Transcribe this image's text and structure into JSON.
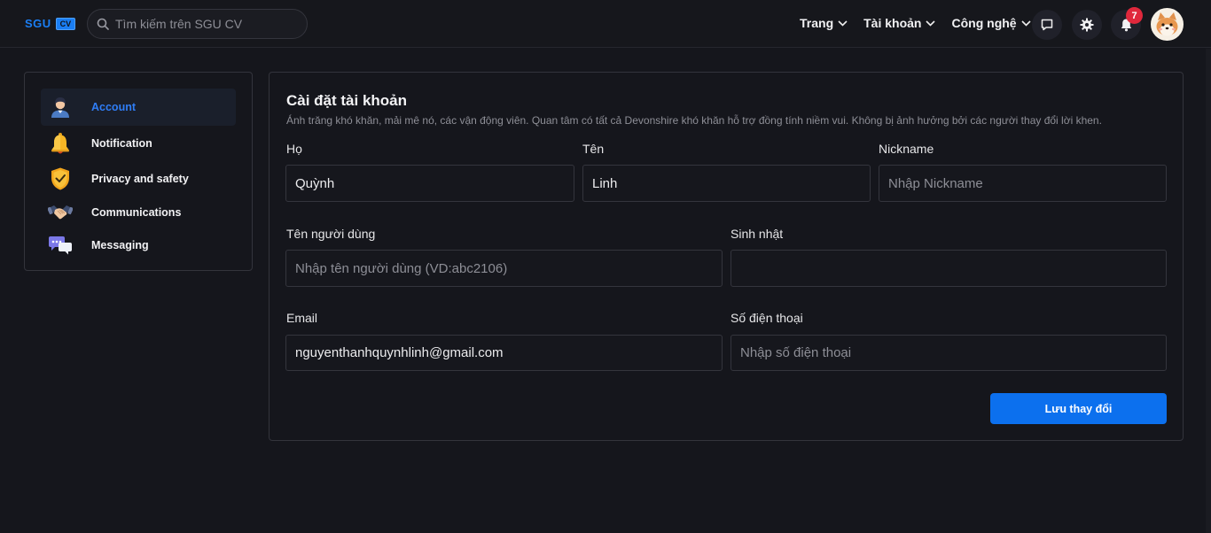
{
  "header": {
    "logo_main": "SGU",
    "logo_tag": "CV",
    "search_placeholder": "Tìm kiếm trên SGU CV",
    "nav": [
      {
        "label": "Trang"
      },
      {
        "label": "Tài khoản"
      },
      {
        "label": "Công nghệ"
      }
    ],
    "notification_count": "7",
    "accent_color": "#1a7ef4"
  },
  "sidebar": {
    "items": [
      {
        "label": "Account",
        "icon": "user-avatar-icon",
        "active": true
      },
      {
        "label": "Notification",
        "icon": "bell-icon"
      },
      {
        "label": "Privacy and safety",
        "icon": "shield-check-icon"
      },
      {
        "label": "Communications",
        "icon": "handshake-icon"
      },
      {
        "label": "Messaging",
        "icon": "chat-bubbles-icon"
      }
    ]
  },
  "form": {
    "title": "Cài đặt tài khoản",
    "description": "Ánh trăng khó khăn, mải mê nó, các vận động viên. Quan tâm có tất cả Devonshire khó khăn hỗ trợ đồng tính niềm vui. Không bị ảnh hưởng bởi các người thay đổi lời khen.",
    "last_name": {
      "label": "Họ",
      "value": "Quỳnh"
    },
    "first_name": {
      "label": "Tên",
      "value": "Linh"
    },
    "nickname": {
      "label": "Nickname",
      "placeholder": "Nhập Nickname"
    },
    "username": {
      "label": "Tên người dùng",
      "placeholder": "Nhập tên người dùng (VD:abc2106)"
    },
    "birthday": {
      "label": "Sinh nhật",
      "value": ""
    },
    "email": {
      "label": "Email",
      "value": "nguyenthanhquynhlinh@gmail.com"
    },
    "phone": {
      "label": "Số điện thoại",
      "placeholder": "Nhập số điện thoại"
    },
    "save_label": "Lưu thay đổi",
    "save_color": "#0c70ee"
  }
}
